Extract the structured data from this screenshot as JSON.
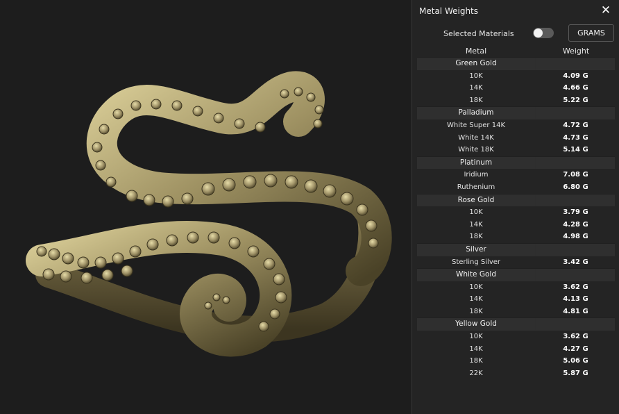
{
  "panel": {
    "title": "Metal Weights",
    "close_icon": "close-icon",
    "selected_materials_label": "Selected Materials",
    "toggle_on": false,
    "units_button": "GRAMS",
    "col_metal": "Metal",
    "col_weight": "Weight"
  },
  "groups": [
    {
      "name": "Green Gold",
      "items": [
        {
          "name": "10K",
          "weight": "4.09 G"
        },
        {
          "name": "14K",
          "weight": "4.66 G"
        },
        {
          "name": "18K",
          "weight": "5.22 G"
        }
      ]
    },
    {
      "name": "Palladium",
      "items": [
        {
          "name": "White Super 14K",
          "weight": "4.72 G"
        },
        {
          "name": "White 14K",
          "weight": "4.73 G"
        },
        {
          "name": "White 18K",
          "weight": "5.14 G"
        }
      ]
    },
    {
      "name": "Platinum",
      "items": [
        {
          "name": "Iridium",
          "weight": "7.08 G"
        },
        {
          "name": "Ruthenium",
          "weight": "6.80 G"
        }
      ]
    },
    {
      "name": "Rose Gold",
      "items": [
        {
          "name": "10K",
          "weight": "3.79 G"
        },
        {
          "name": "14K",
          "weight": "4.28 G"
        },
        {
          "name": "18K",
          "weight": "4.98 G"
        }
      ]
    },
    {
      "name": "Silver",
      "items": [
        {
          "name": "Sterling Silver",
          "weight": "3.42 G"
        }
      ]
    },
    {
      "name": "White Gold",
      "items": [
        {
          "name": "10K",
          "weight": "3.62 G"
        },
        {
          "name": "14K",
          "weight": "4.13 G"
        },
        {
          "name": "18K",
          "weight": "4.81 G"
        }
      ]
    },
    {
      "name": "Yellow Gold",
      "items": [
        {
          "name": "10K",
          "weight": "3.62 G"
        },
        {
          "name": "14K",
          "weight": "4.27 G"
        },
        {
          "name": "18K",
          "weight": "5.06 G"
        },
        {
          "name": "22K",
          "weight": "5.87 G"
        }
      ]
    }
  ],
  "colors": {
    "metal_light": "#d8cc96",
    "metal_mid": "#9e9162",
    "metal_dark": "#4a4227"
  }
}
